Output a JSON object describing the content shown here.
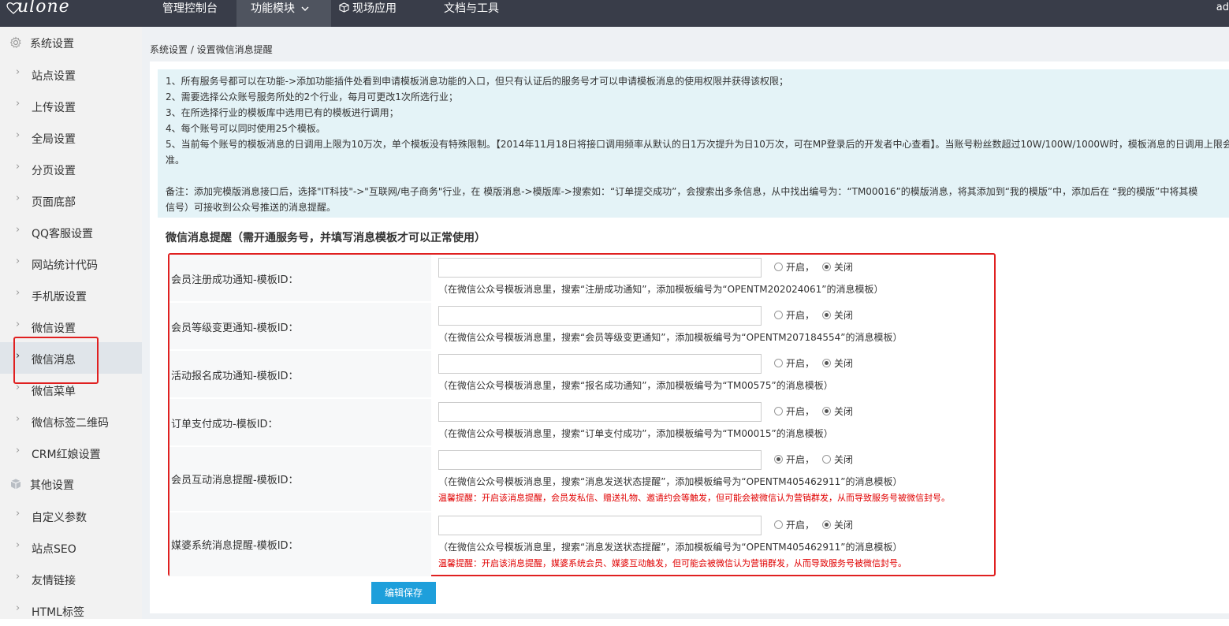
{
  "logo": {
    "text": "ulone"
  },
  "nav": [
    "管理控制台",
    "功能模块",
    "现场应用",
    "文档与工具"
  ],
  "nav_dropdown_icon": "chevron-down-icon",
  "nav_cube_icon": "cube-icon",
  "user": {
    "text": "ad"
  },
  "sidebar": {
    "group1": {
      "icon": "gear-icon",
      "label": "系统设置"
    },
    "items1": [
      "站点设置",
      "上传设置",
      "全局设置",
      "分页设置",
      "页面底部",
      "QQ客服设置",
      "网站统计代码",
      "手机版设置",
      "微信设置",
      "微信消息",
      "微信菜单",
      "微信标签二维码",
      "CRM红娘设置"
    ],
    "active": "微信消息",
    "group2": {
      "icon": "cube-icon",
      "label": "其他设置"
    },
    "items2": [
      "自定义参数",
      "站点SEO",
      "友情链接",
      "HTML标签"
    ]
  },
  "breadcrumb": "系统设置 / 设置微信消息提醒",
  "notice": [
    "1、所有服务号都可以在功能->添加功能插件处看到申请模板消息功能的入口，但只有认证后的服务号才可以申请模板消息的使用权限并获得该权限；",
    "2、需要选择公众账号服务所处的2个行业，每月可更改1次所选行业；",
    "3、在所选择行业的模板库中选用已有的模板进行调用；",
    "4、每个账号可以同时使用25个模板。",
    "5、当前每个账号的模板消息的日调用上限为10万次，单个模板没有特殊限制。【2014年11月18日将接口调用频率从默认的日1万次提升为日10万次，可在MP登录后的开发者中心查看】。当账号粉丝数超过10W/100W/1000W时，模板消息的日调用上限会",
    "准。",
    "备注：添加完模版消息接口后，选择\"IT科技\"->\"互联网/电子商务\"行业，在 模版消息->模版库->搜索如：“订单提交成功”，会搜索出多条信息，从中找出编号为：“TM00016”的模版消息，将其添加到“我的模版”中，添加后在 “我的模版”中将其模",
    "信号）可接收到公众号推送的消息提醒。"
  ],
  "section_title": "微信消息提醒（需开通服务号，并填写消息模板才可以正常使用）",
  "radio_on_label": "开启，",
  "radio_off_label": "关闭",
  "rows": [
    {
      "label": "会员注册成功通知-模板ID：",
      "value": "",
      "enabled": false,
      "hint": "（在微信公众号模板消息里，搜索“注册成功通知”，添加模板编号为“OPENTM202024061”的消息模板）",
      "warn": ""
    },
    {
      "label": "会员等级变更通知-模板ID：",
      "value": "",
      "enabled": false,
      "hint": "（在微信公众号模板消息里，搜索“会员等级变更通知”，添加模板编号为“OPENTM207184554”的消息模板）",
      "warn": ""
    },
    {
      "label": "活动报名成功通知-模板ID：",
      "value": "",
      "enabled": false,
      "hint": "（在微信公众号模板消息里，搜索“报名成功通知”，添加模板编号为“TM00575”的消息模板）",
      "warn": ""
    },
    {
      "label": "订单支付成功-模板ID：",
      "value": "",
      "enabled": false,
      "hint": "（在微信公众号模板消息里，搜索“订单支付成功”，添加模板编号为“TM00015”的消息模板）",
      "warn": ""
    },
    {
      "label": "会员互动消息提醒-模板ID：",
      "value": "",
      "enabled": true,
      "hint": "（在微信公众号模板消息里，搜索“消息发送状态提醒”，添加模板编号为“OPENTM405462911”的消息模板）",
      "warn": "温馨提醒：开启该消息提醒，会员发私信、赠送礼物、邀请约会等触发，但可能会被微信认为营销群发，从而导致服务号被微信封号。"
    },
    {
      "label": "媒婆系统消息提醒-模板ID：",
      "value": "",
      "enabled": false,
      "hint": "（在微信公众号模板消息里，搜索“消息发送状态提醒”，添加模板编号为“OPENTM405462911”的消息模板）",
      "warn": "温馨提醒：开启该消息提醒，媒婆系统会员、媒婆互动触发，但可能会被微信认为营销群发，从而导致服务号被微信封号。"
    }
  ],
  "save_label": "编辑保存",
  "colors": {
    "topbar": "#393d49",
    "sidebar": "#f2f2f2",
    "notice": "#e4f3f7",
    "button": "#1e9fdb",
    "warning": "#e00000",
    "highlight_box": "#e02020"
  }
}
